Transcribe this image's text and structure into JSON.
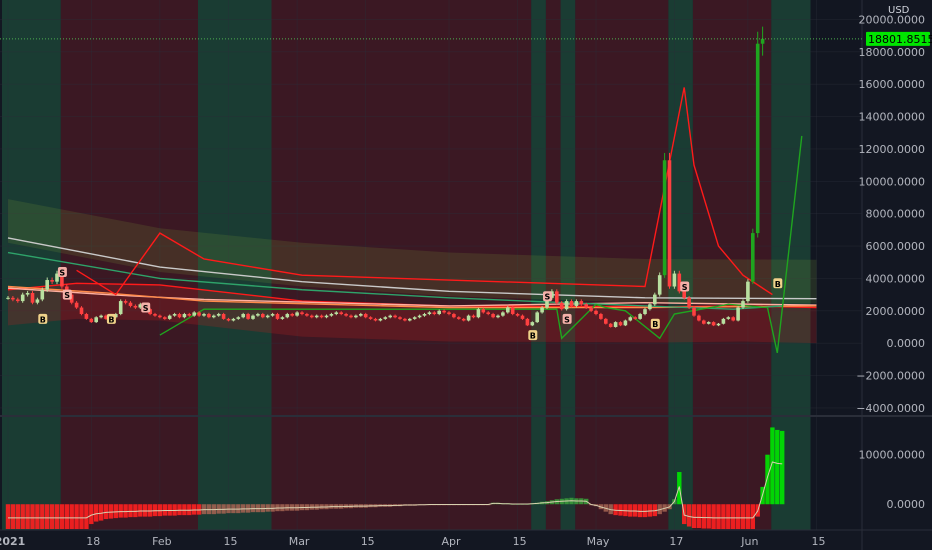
{
  "chart_data": [
    {
      "type": "candlestick",
      "pane": "price",
      "currency": "USD",
      "current_price": "18801.8515",
      "y_ticks": [
        "20000.0000",
        "18000.0000",
        "16000.0000",
        "14000.0000",
        "12000.0000",
        "10000.0000",
        "8000.0000",
        "6000.0000",
        "4000.0000",
        "2000.0000",
        "0.0000",
        "−2000.0000",
        "−4000.0000"
      ],
      "ylim": [
        -4500,
        21200
      ],
      "x_ticks": [
        {
          "label": "2021",
          "day": 0,
          "bold": true
        },
        {
          "label": "18",
          "day": 17
        },
        {
          "label": "Feb",
          "day": 31
        },
        {
          "label": "15",
          "day": 45
        },
        {
          "label": "Mar",
          "day": 59
        },
        {
          "label": "15",
          "day": 73
        },
        {
          "label": "Apr",
          "day": 90
        },
        {
          "label": "15",
          "day": 104
        },
        {
          "label": "May",
          "day": 120
        },
        {
          "label": "17",
          "day": 136
        },
        {
          "label": "Jun",
          "day": 151
        },
        {
          "label": "15",
          "day": 165
        }
      ],
      "signals": [
        {
          "label": "B",
          "day": 7,
          "value": 1500
        },
        {
          "label": "S",
          "day": 11,
          "value": 4400
        },
        {
          "label": "S",
          "day": 12,
          "value": 3000
        },
        {
          "label": "B",
          "day": 21,
          "value": 1500
        },
        {
          "label": "S",
          "day": 28,
          "value": 2200
        },
        {
          "label": "B",
          "day": 107,
          "value": 500
        },
        {
          "label": "S",
          "day": 110,
          "value": 2900
        },
        {
          "label": "S",
          "day": 114,
          "value": 1500
        },
        {
          "label": "B",
          "day": 132,
          "value": 1200
        },
        {
          "label": "S",
          "day": 138,
          "value": 3500
        },
        {
          "label": "B",
          "day": 157,
          "value": 3700
        }
      ],
      "close_series": [
        2800,
        2700,
        2600,
        3000,
        3100,
        2500,
        2700,
        3300,
        3900,
        3800,
        4300,
        3500,
        3000,
        2500,
        2200,
        1800,
        1500,
        1300,
        1600,
        1700,
        1500,
        1600,
        1800,
        2600,
        2500,
        2300,
        2200,
        2400,
        2100,
        1800,
        1700,
        1600,
        1500,
        1700,
        1800,
        1600,
        1800,
        1700,
        1900,
        1700,
        1800,
        1600,
        1700,
        1800,
        1500,
        1400,
        1500,
        1600,
        1800,
        1500,
        1700,
        1800,
        1600,
        1700,
        1800,
        1500,
        1600,
        1800,
        1700,
        1900,
        1800,
        1700,
        1600,
        1700,
        1600,
        1700,
        1800,
        1900,
        1800,
        1700,
        1600,
        1700,
        1800,
        1600,
        1500,
        1400,
        1500,
        1600,
        1700,
        1600,
        1500,
        1400,
        1500,
        1600,
        1700,
        1800,
        1900,
        1800,
        2000,
        1900,
        1800,
        1600,
        1500,
        1400,
        1700,
        1600,
        2100,
        1900,
        1800,
        1600,
        1700,
        1900,
        2200,
        1800,
        1700,
        1500,
        1100,
        1300,
        1900,
        2200,
        2800,
        3200,
        2500,
        2100,
        2600,
        2300,
        2600,
        2400,
        2200,
        2000,
        1800,
        1500,
        1200,
        1000,
        1300,
        1100,
        1400,
        1600,
        1500,
        1800,
        2100,
        2400,
        3000,
        4200,
        11300,
        3500,
        4300,
        3200,
        2800,
        2200,
        1700,
        1400,
        1200,
        1300,
        1100,
        1200,
        1500,
        1600,
        1400,
        2200,
        2600,
        3800,
        6800,
        18500,
        18801.8515
      ],
      "moving_averages": [
        {
          "color": "#ff1a1a",
          "values": [
            [
              0,
              3300
            ],
            [
              14,
              3700
            ],
            [
              31,
              3600
            ],
            [
              60,
              2600
            ],
            [
              90,
              2300
            ],
            [
              135,
              2250
            ],
            [
              150,
              2300
            ],
            [
              165,
              2200
            ]
          ]
        },
        {
          "color": "#ffb0a0",
          "values": [
            [
              0,
              3400
            ],
            [
              20,
              3000
            ],
            [
              40,
              2700
            ],
            [
              90,
              2300
            ],
            [
              130,
              2500
            ],
            [
              165,
              2350
            ]
          ]
        },
        {
          "color": "#ff8a4a",
          "values": [
            [
              0,
              3500
            ],
            [
              20,
              3100
            ],
            [
              40,
              2600
            ],
            [
              90,
              2200
            ],
            [
              130,
              2200
            ],
            [
              165,
              2300
            ]
          ]
        },
        {
          "color": "#2ea36a",
          "values": [
            [
              0,
              5600
            ],
            [
              31,
              4000
            ],
            [
              60,
              3300
            ],
            [
              90,
              2800
            ],
            [
              130,
              2300
            ],
            [
              148,
              2100
            ],
            [
              158,
              2300
            ]
          ]
        },
        {
          "color": "#c9c9c9",
          "values": [
            [
              0,
              6500
            ],
            [
              31,
              4700
            ],
            [
              60,
              3800
            ],
            [
              90,
              3200
            ],
            [
              130,
              2800
            ],
            [
              165,
              2750
            ]
          ]
        }
      ],
      "stop_line": [
        [
          14,
          4500
        ],
        [
          22,
          3000
        ],
        [
          31,
          6800
        ],
        [
          40,
          5200
        ],
        [
          60,
          4200
        ],
        [
          90,
          3900
        ],
        [
          130,
          3500
        ],
        [
          138,
          15800
        ],
        [
          140,
          11000
        ],
        [
          145,
          6000
        ],
        [
          150,
          4200
        ],
        [
          156,
          3000
        ]
      ],
      "trail_line": [
        [
          31,
          500
        ],
        [
          40,
          2100
        ],
        [
          60,
          2100
        ],
        [
          90,
          2100
        ],
        [
          112,
          2100
        ],
        [
          113,
          300
        ],
        [
          120,
          2400
        ],
        [
          122,
          2200
        ],
        [
          126,
          2000
        ],
        [
          133,
          300
        ],
        [
          136,
          1800
        ],
        [
          147,
          2400
        ],
        [
          155,
          2200
        ],
        [
          157,
          -600
        ],
        [
          162,
          12800
        ]
      ]
    },
    {
      "type": "histogram",
      "pane": "oscillator",
      "y_ticks": [
        "10000.0000",
        "0.0000"
      ],
      "ylim": [
        -5200,
        17000
      ],
      "values": [
        -5000,
        -5000,
        -5000,
        -5000,
        -5000,
        -5000,
        -5000,
        -5000,
        -5000,
        -5000,
        -5000,
        -5000,
        -5000,
        -5000,
        -5000,
        -5000,
        -5000,
        -4000,
        -3500,
        -3300,
        -3000,
        -2900,
        -2800,
        -2700,
        -2700,
        -2600,
        -2600,
        -2500,
        -2500,
        -2500,
        -2400,
        -2400,
        -2300,
        -2300,
        -2300,
        -2200,
        -2200,
        -2200,
        -2100,
        -2100,
        -2000,
        -2000,
        -2000,
        -1900,
        -1900,
        -1800,
        -1800,
        -1800,
        -1700,
        -1700,
        -1600,
        -1600,
        -1600,
        -1500,
        -1500,
        -1400,
        -1400,
        -1300,
        -1300,
        -1300,
        -1200,
        -1200,
        -1100,
        -1100,
        -1000,
        -1000,
        -900,
        -900,
        -900,
        -800,
        -800,
        -700,
        -700,
        -700,
        -600,
        -600,
        -500,
        -500,
        -500,
        -400,
        -400,
        -300,
        -300,
        -300,
        -200,
        -200,
        -100,
        -100,
        -100,
        -100,
        -100,
        -100,
        -100,
        -100,
        -100,
        -100,
        -100,
        -100,
        -100,
        300,
        300,
        200,
        200,
        100,
        100,
        100,
        100,
        200,
        300,
        500,
        600,
        800,
        1000,
        1100,
        1200,
        1300,
        1200,
        1200,
        1100,
        -100,
        -400,
        -1000,
        -1500,
        -2000,
        -2200,
        -2300,
        -2400,
        -2500,
        -2500,
        -2600,
        -2600,
        -2500,
        -2400,
        -2000,
        -1500,
        -1000,
        1000,
        6500,
        -4000,
        -4500,
        -4800,
        -4800,
        -4900,
        -4900,
        -5000,
        -5000,
        -5000,
        -5000,
        -5000,
        -5000,
        -5000,
        -5000,
        -5000,
        -2500,
        3500,
        10000,
        15500,
        15000,
        14800
      ]
    }
  ]
}
